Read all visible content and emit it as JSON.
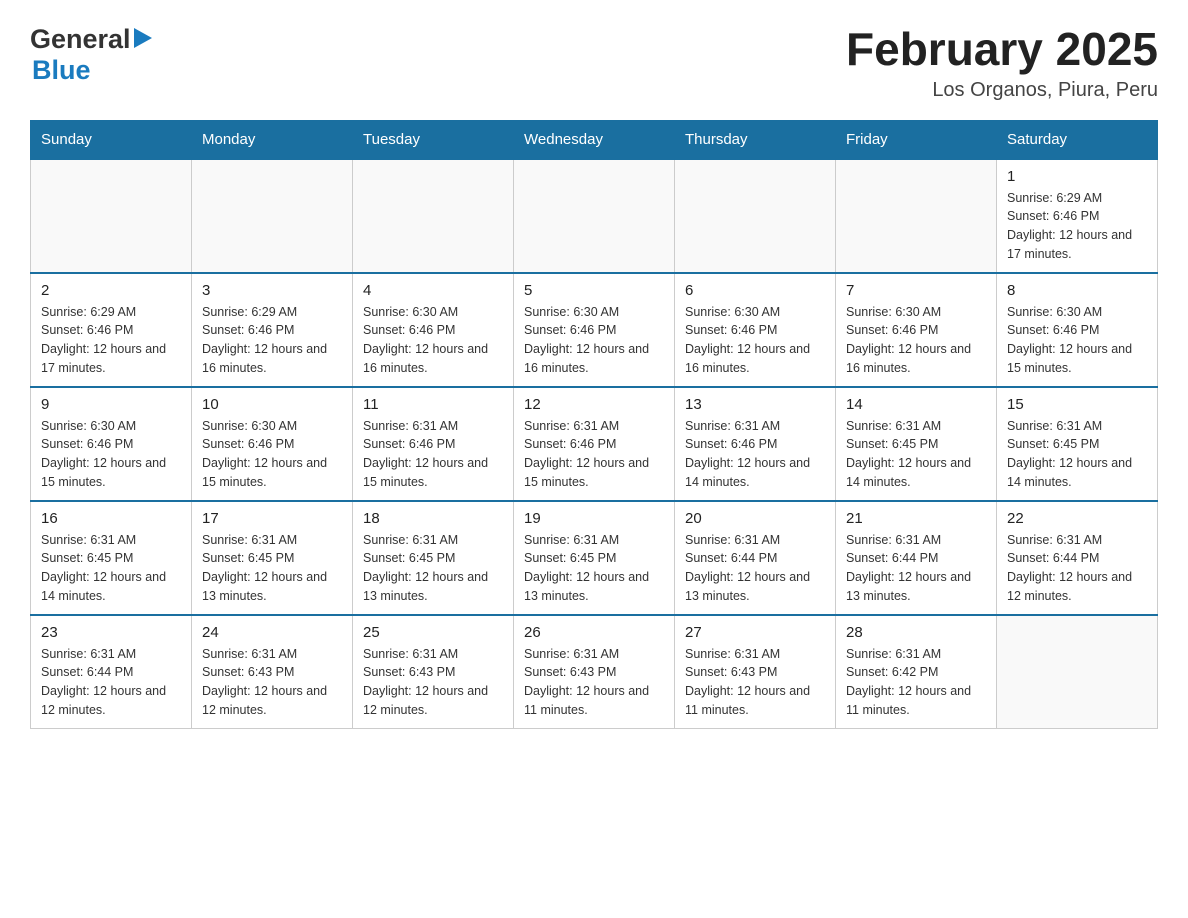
{
  "header": {
    "title": "February 2025",
    "subtitle": "Los Organos, Piura, Peru"
  },
  "logo": {
    "general": "General",
    "blue": "Blue"
  },
  "days_of_week": [
    "Sunday",
    "Monday",
    "Tuesday",
    "Wednesday",
    "Thursday",
    "Friday",
    "Saturday"
  ],
  "weeks": [
    {
      "days": [
        {
          "number": "",
          "info": ""
        },
        {
          "number": "",
          "info": ""
        },
        {
          "number": "",
          "info": ""
        },
        {
          "number": "",
          "info": ""
        },
        {
          "number": "",
          "info": ""
        },
        {
          "number": "",
          "info": ""
        },
        {
          "number": "1",
          "info": "Sunrise: 6:29 AM\nSunset: 6:46 PM\nDaylight: 12 hours and 17 minutes."
        }
      ]
    },
    {
      "days": [
        {
          "number": "2",
          "info": "Sunrise: 6:29 AM\nSunset: 6:46 PM\nDaylight: 12 hours and 17 minutes."
        },
        {
          "number": "3",
          "info": "Sunrise: 6:29 AM\nSunset: 6:46 PM\nDaylight: 12 hours and 16 minutes."
        },
        {
          "number": "4",
          "info": "Sunrise: 6:30 AM\nSunset: 6:46 PM\nDaylight: 12 hours and 16 minutes."
        },
        {
          "number": "5",
          "info": "Sunrise: 6:30 AM\nSunset: 6:46 PM\nDaylight: 12 hours and 16 minutes."
        },
        {
          "number": "6",
          "info": "Sunrise: 6:30 AM\nSunset: 6:46 PM\nDaylight: 12 hours and 16 minutes."
        },
        {
          "number": "7",
          "info": "Sunrise: 6:30 AM\nSunset: 6:46 PM\nDaylight: 12 hours and 16 minutes."
        },
        {
          "number": "8",
          "info": "Sunrise: 6:30 AM\nSunset: 6:46 PM\nDaylight: 12 hours and 15 minutes."
        }
      ]
    },
    {
      "days": [
        {
          "number": "9",
          "info": "Sunrise: 6:30 AM\nSunset: 6:46 PM\nDaylight: 12 hours and 15 minutes."
        },
        {
          "number": "10",
          "info": "Sunrise: 6:30 AM\nSunset: 6:46 PM\nDaylight: 12 hours and 15 minutes."
        },
        {
          "number": "11",
          "info": "Sunrise: 6:31 AM\nSunset: 6:46 PM\nDaylight: 12 hours and 15 minutes."
        },
        {
          "number": "12",
          "info": "Sunrise: 6:31 AM\nSunset: 6:46 PM\nDaylight: 12 hours and 15 minutes."
        },
        {
          "number": "13",
          "info": "Sunrise: 6:31 AM\nSunset: 6:46 PM\nDaylight: 12 hours and 14 minutes."
        },
        {
          "number": "14",
          "info": "Sunrise: 6:31 AM\nSunset: 6:45 PM\nDaylight: 12 hours and 14 minutes."
        },
        {
          "number": "15",
          "info": "Sunrise: 6:31 AM\nSunset: 6:45 PM\nDaylight: 12 hours and 14 minutes."
        }
      ]
    },
    {
      "days": [
        {
          "number": "16",
          "info": "Sunrise: 6:31 AM\nSunset: 6:45 PM\nDaylight: 12 hours and 14 minutes."
        },
        {
          "number": "17",
          "info": "Sunrise: 6:31 AM\nSunset: 6:45 PM\nDaylight: 12 hours and 13 minutes."
        },
        {
          "number": "18",
          "info": "Sunrise: 6:31 AM\nSunset: 6:45 PM\nDaylight: 12 hours and 13 minutes."
        },
        {
          "number": "19",
          "info": "Sunrise: 6:31 AM\nSunset: 6:45 PM\nDaylight: 12 hours and 13 minutes."
        },
        {
          "number": "20",
          "info": "Sunrise: 6:31 AM\nSunset: 6:44 PM\nDaylight: 12 hours and 13 minutes."
        },
        {
          "number": "21",
          "info": "Sunrise: 6:31 AM\nSunset: 6:44 PM\nDaylight: 12 hours and 13 minutes."
        },
        {
          "number": "22",
          "info": "Sunrise: 6:31 AM\nSunset: 6:44 PM\nDaylight: 12 hours and 12 minutes."
        }
      ]
    },
    {
      "days": [
        {
          "number": "23",
          "info": "Sunrise: 6:31 AM\nSunset: 6:44 PM\nDaylight: 12 hours and 12 minutes."
        },
        {
          "number": "24",
          "info": "Sunrise: 6:31 AM\nSunset: 6:43 PM\nDaylight: 12 hours and 12 minutes."
        },
        {
          "number": "25",
          "info": "Sunrise: 6:31 AM\nSunset: 6:43 PM\nDaylight: 12 hours and 12 minutes."
        },
        {
          "number": "26",
          "info": "Sunrise: 6:31 AM\nSunset: 6:43 PM\nDaylight: 12 hours and 11 minutes."
        },
        {
          "number": "27",
          "info": "Sunrise: 6:31 AM\nSunset: 6:43 PM\nDaylight: 12 hours and 11 minutes."
        },
        {
          "number": "28",
          "info": "Sunrise: 6:31 AM\nSunset: 6:42 PM\nDaylight: 12 hours and 11 minutes."
        },
        {
          "number": "",
          "info": ""
        }
      ]
    }
  ]
}
